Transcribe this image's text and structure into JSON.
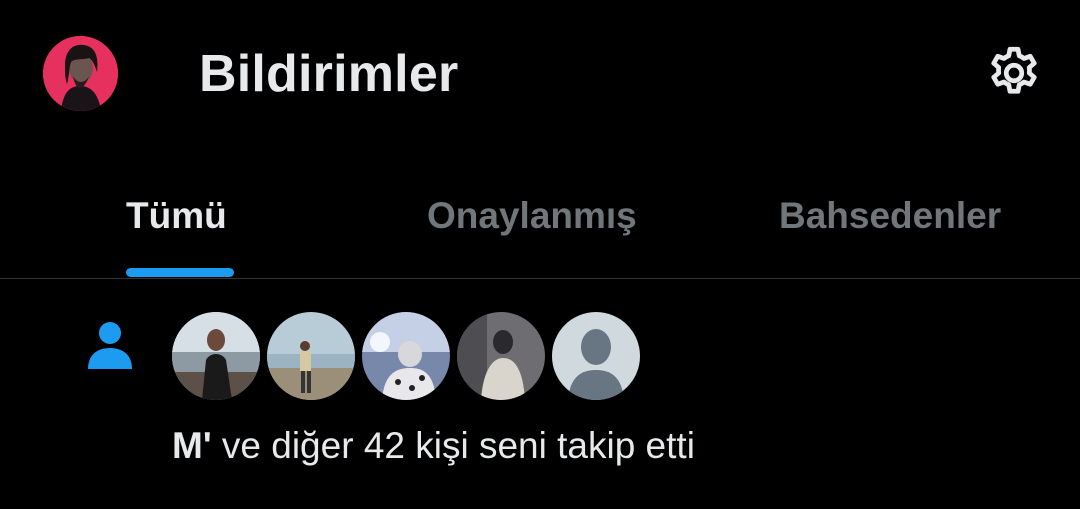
{
  "header": {
    "title": "Bildirimler",
    "profile_avatar_icon": "user-profile-avatar",
    "settings_icon": "gear-icon"
  },
  "tabs": [
    {
      "label": "Tümü",
      "active": true
    },
    {
      "label": "Onaylanmış",
      "active": false
    },
    {
      "label": "Bahsedenler",
      "active": false
    }
  ],
  "notification": {
    "icon": "person-icon",
    "name": "M'",
    "text": " ve diğer 42 kişi seni takip etti",
    "avatar_count": 5
  },
  "colors": {
    "background": "#000000",
    "accent": "#1d9bf0",
    "text_primary": "#e7e9ea",
    "text_secondary": "#71767b",
    "profile_ring": "#e6305d"
  }
}
